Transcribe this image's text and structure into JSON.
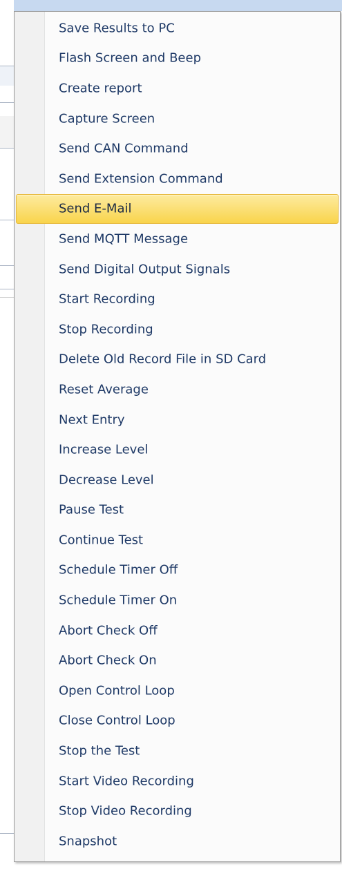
{
  "menu": {
    "highlighted_index": 6,
    "items": [
      {
        "label": "Save Results to PC"
      },
      {
        "label": "Flash Screen and Beep"
      },
      {
        "label": "Create report"
      },
      {
        "label": "Capture Screen"
      },
      {
        "label": "Send CAN Command"
      },
      {
        "label": "Send Extension Command"
      },
      {
        "label": "Send E-Mail"
      },
      {
        "label": "Send MQTT Message"
      },
      {
        "label": "Send Digital Output Signals"
      },
      {
        "label": "Start Recording"
      },
      {
        "label": "Stop Recording"
      },
      {
        "label": "Delete Old Record File in SD Card"
      },
      {
        "label": "Reset Average"
      },
      {
        "label": "Next Entry"
      },
      {
        "label": "Increase Level"
      },
      {
        "label": "Decrease Level"
      },
      {
        "label": "Pause Test"
      },
      {
        "label": "Continue Test"
      },
      {
        "label": "Schedule Timer Off"
      },
      {
        "label": "Schedule Timer On"
      },
      {
        "label": "Abort Check Off"
      },
      {
        "label": "Abort Check On"
      },
      {
        "label": "Open Control Loop"
      },
      {
        "label": "Close Control Loop"
      },
      {
        "label": "Stop the Test"
      },
      {
        "label": "Start Video Recording"
      },
      {
        "label": "Stop Video Recording"
      },
      {
        "label": "Snapshot"
      }
    ]
  },
  "colors": {
    "menu_text": "#1e3966",
    "highlight_top": "#fdeb9f",
    "highlight_bottom": "#f9d44c",
    "highlight_border": "#e6b93c",
    "gutter": "#f1f1f1"
  }
}
